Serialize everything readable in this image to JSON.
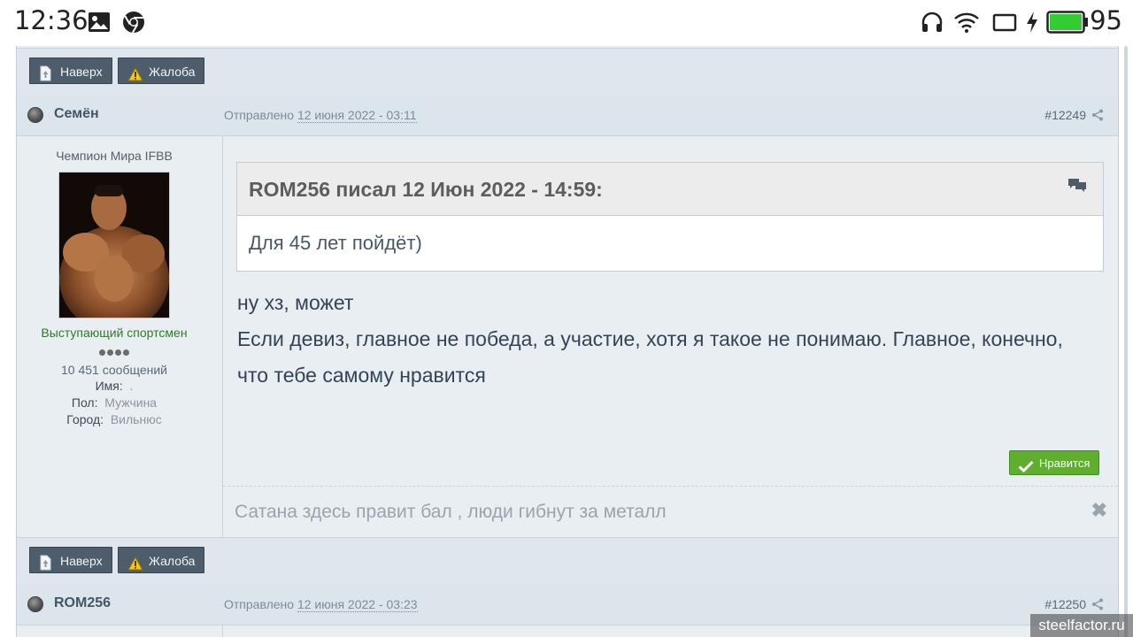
{
  "statusbar": {
    "time": "12:36",
    "battery_level": "95",
    "icons": [
      "image-icon",
      "chrome-icon",
      "headphones-icon",
      "wifi-icon",
      "cast-icon",
      "charging-icon",
      "battery-icon"
    ]
  },
  "post_top_buttons": {
    "up_label": "Наверх",
    "complain_label": "Жалоба"
  },
  "post": {
    "author": "Семён",
    "sent_label": "Отправлено",
    "sent_date": "12 июня 2022 - 03:11",
    "post_number": "#12249",
    "author_title": "Чемпион Мира IFBB",
    "author_rank": "Выступающий спортсмен",
    "message_count": "10 451 сообщений",
    "name_label": "Имя:",
    "name_value": ".",
    "gender_label": "Пол:",
    "gender_value": "Мужчина",
    "city_label": "Город:",
    "city_value": "Вильнюс",
    "quote_header": "ROM256 писал 12 Июн 2022 - 14:59:",
    "quote_text": "Для 45 лет пойдёт)",
    "text_line1": "ну хз, может",
    "text_line2": "Если девиз, главное не победа, а участие, хотя я такое не понимаю. Главное, конечно, что тебе самому нравится",
    "like_label": "Нравится",
    "signature": "Сатана здесь правит бал , люди гибнут за металл"
  },
  "post_bottom_buttons": {
    "up_label": "Наверх",
    "complain_label": "Жалоба"
  },
  "next_post": {
    "author": "ROM256",
    "sent_label": "Отправлено",
    "sent_date": "12 июня 2022 - 03:23",
    "post_number": "#12250"
  },
  "watermark": "steelfactor.ru",
  "colors": {
    "button_bg": "#4e5d6c",
    "like_green": "#5fae2f",
    "rank_green": "#2f7a2a",
    "frame_bg": "#e8edf2"
  }
}
